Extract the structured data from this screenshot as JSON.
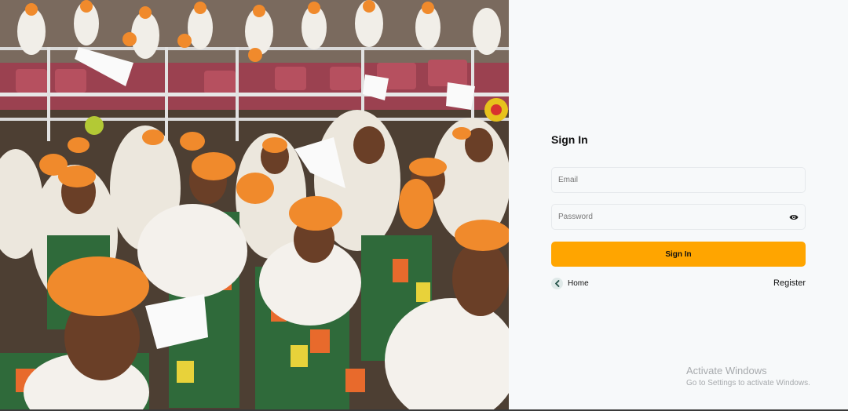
{
  "signin": {
    "title": "Sign In",
    "email_placeholder": "Email",
    "password_placeholder": "Password",
    "submit_label": "Sign In",
    "home_label": "Home",
    "register_label": "Register"
  },
  "icons": {
    "eye": "eye-icon",
    "home_back": "chevron-left-icon"
  },
  "watermark": {
    "title": "Activate Windows",
    "subtitle": "Go to Settings to activate Windows."
  },
  "colors": {
    "accent": "#ffa500",
    "panel_background": "#f7f9fa",
    "headwrap_orange": "#f08a2c"
  }
}
